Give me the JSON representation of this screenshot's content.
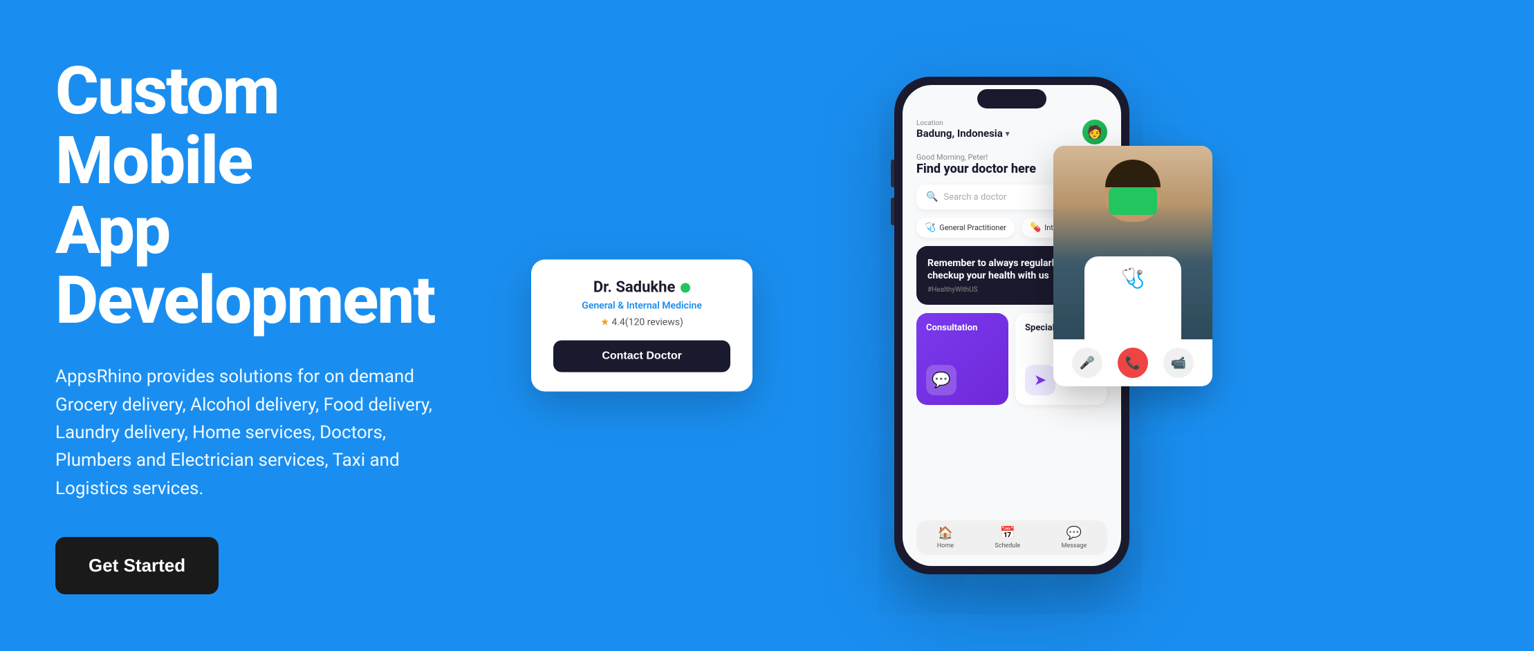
{
  "hero": {
    "title_line1": "Custom Mobile",
    "title_line2": "App",
    "title_line3": "Development",
    "description": "AppsRhino provides solutions for on demand Grocery delivery, Alcohol delivery, Food delivery, Laundry delivery, Home services, Doctors, Plumbers and Electrician services, Taxi and Logistics services.",
    "cta_label": "Get Started"
  },
  "phone": {
    "location_label": "Location",
    "location_name": "Badung, Indonesia",
    "greeting_sub": "Good Morning, Peter!",
    "greeting_main": "Find your doctor here",
    "search_placeholder": "Search a doctor",
    "categories": [
      {
        "icon": "🩺",
        "label": "General Practitioner"
      },
      {
        "icon": "💊",
        "label": "Internal Practitioner"
      }
    ],
    "health_card": {
      "title": "Remember to always regularly checkup your health with us",
      "tag": "#HealthyWithUS"
    },
    "services": [
      {
        "key": "consultation",
        "label": "Consultation",
        "icon": "💬"
      },
      {
        "key": "special",
        "label": "Special",
        "icon": "📍"
      }
    ],
    "nav_items": [
      {
        "icon": "🏠",
        "label": "Home"
      },
      {
        "icon": "📅",
        "label": "Schedule"
      },
      {
        "icon": "💬",
        "label": "Message"
      }
    ]
  },
  "doctor_card": {
    "name": "Dr. Sadukhe",
    "online_status": "online",
    "specialty": "General & Internal Medicine",
    "rating": "4.4",
    "reviews": "120 reviews",
    "contact_label": "Contact Doctor"
  },
  "video_call": {
    "controls": [
      {
        "key": "mute",
        "icon": "🎤"
      },
      {
        "key": "end",
        "icon": "📞"
      },
      {
        "key": "video",
        "icon": "📹"
      }
    ]
  }
}
